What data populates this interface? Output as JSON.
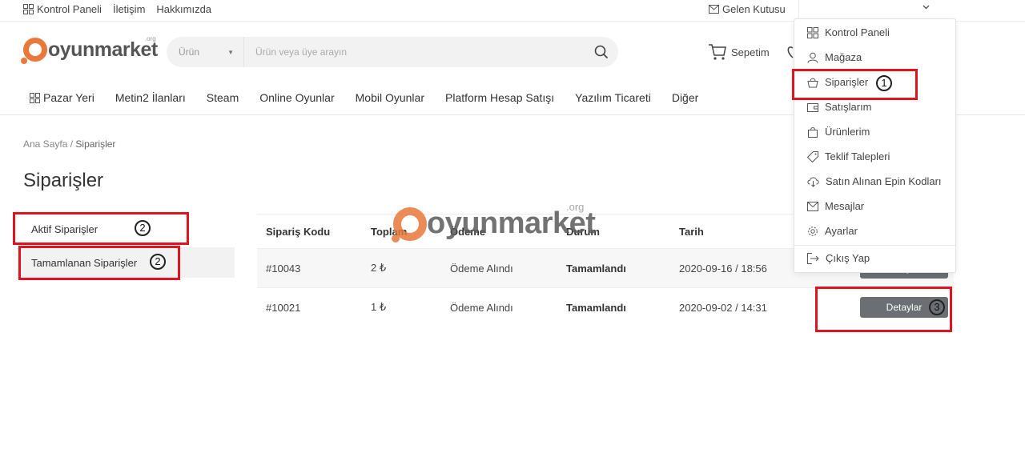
{
  "topbar": {
    "links": [
      "Kontrol Paneli",
      "İletişim",
      "Hakkımızda"
    ],
    "inbox": "Gelen Kutusu"
  },
  "brand": {
    "name": "oyunmarket",
    "suffix": ".org"
  },
  "search": {
    "category": "Ürün",
    "placeholder": "Ürün veya üye arayın"
  },
  "cart": {
    "label": "Sepetim"
  },
  "nav": [
    "Pazar Yeri",
    "Metin2 İlanları",
    "Steam",
    "Online Oyunlar",
    "Mobil Oyunlar",
    "Platform Hesap Satışı",
    "Yazılım Ticareti",
    "Diğer"
  ],
  "breadcrumb": {
    "home": "Ana Sayfa",
    "separator": "/",
    "current": "Siparişler"
  },
  "page_title": "Siparişler",
  "sidebar": [
    "Aktif Siparişler",
    "Tamamlanan Siparişler"
  ],
  "table": {
    "headers": [
      "Sipariş Kodu",
      "Toplam",
      "Ödeme",
      "Durum",
      "Tarih"
    ],
    "rows": [
      {
        "code": "#10043",
        "total": "2 ₺",
        "payment": "Ödeme Alındı",
        "status": "Tamamlandı",
        "date": "2020-09-16 / 18:56",
        "action": "Detaylar"
      },
      {
        "code": "#10021",
        "total": "1 ₺",
        "payment": "Ödeme Alındı",
        "status": "Tamamlandı",
        "date": "2020-09-02 / 14:31",
        "action": "Detaylar"
      }
    ]
  },
  "dropdown": {
    "items": [
      "Kontrol Paneli",
      "Mağaza",
      "Siparişler",
      "Satışlarım",
      "Ürünlerim",
      "Teklif Talepleri",
      "Satın Alınan Epin Kodları",
      "Mesajlar",
      "Ayarlar"
    ],
    "logout": "Çıkış Yap"
  },
  "annotations": {
    "step1": "1",
    "step2": "2",
    "step3": "3",
    "color": "#e0141e"
  },
  "colors": {
    "brand_orange": "#e8793a",
    "button_gray": "#6b6e72"
  }
}
